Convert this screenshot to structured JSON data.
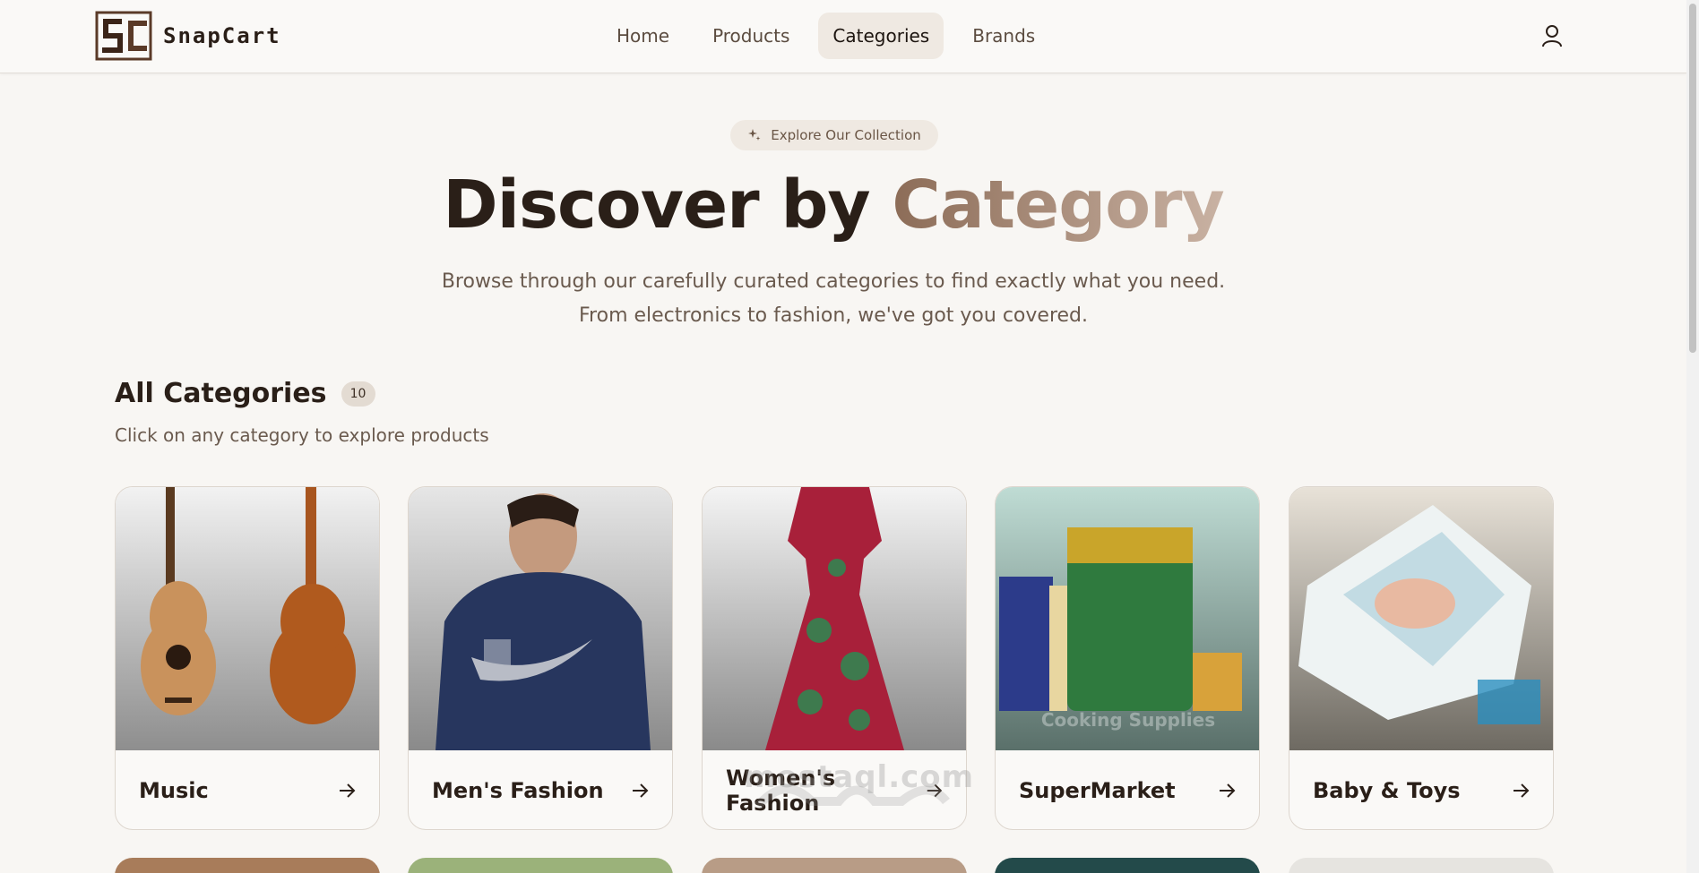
{
  "brand": {
    "name": "SnapCart",
    "monogram": "SC"
  },
  "nav": [
    {
      "label": "Home",
      "active": false
    },
    {
      "label": "Products",
      "active": false
    },
    {
      "label": "Categories",
      "active": true
    },
    {
      "label": "Brands",
      "active": false
    }
  ],
  "hero": {
    "pill": "Explore Our Collection",
    "title_main": "Discover by",
    "title_accent": "Category",
    "subtitle": "Browse through our carefully curated categories to find exactly what you need. From electronics to fashion, we've got you covered."
  },
  "section": {
    "title": "All Categories",
    "count": "10",
    "subtitle": "Click on any category to explore products"
  },
  "categories": [
    {
      "name": "Music",
      "image": "acoustic-guitars"
    },
    {
      "name": "Men's Fashion",
      "image": "man-in-hoodie"
    },
    {
      "name": "Women's Fashion",
      "image": "floral-dress"
    },
    {
      "name": "SuperMarket",
      "image": "grocery-products",
      "overlay_text": "Cooking Supplies"
    },
    {
      "name": "Baby & Toys",
      "image": "diaper-package"
    }
  ],
  "watermark": "mostaql.com",
  "colors": {
    "accent": "#8c6c57",
    "background": "#f8f6f3",
    "text": "#2a1f18"
  }
}
